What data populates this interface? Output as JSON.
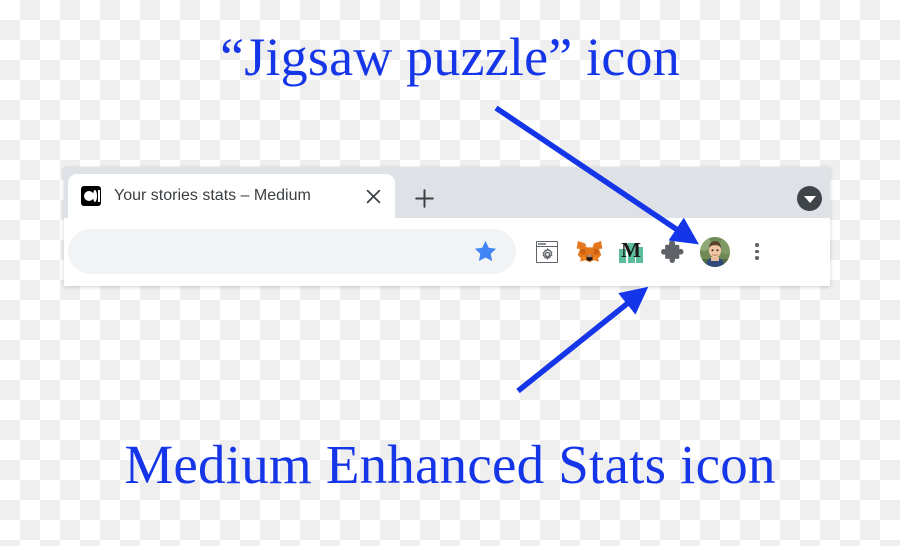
{
  "annotations": {
    "top": "“Jigsaw puzzle” icon",
    "bottom": "Medium Enhanced Stats icon",
    "arrow_color": "#1536e8",
    "text_color": "#1536e8"
  },
  "browser": {
    "tab_strip": {
      "tabs": [
        {
          "title": "Your stories stats – Medium",
          "favicon": "medium-favicon",
          "close_label": "×",
          "active": true
        }
      ],
      "new_tab_label": "+",
      "tab_list_icon": "caret-down-icon"
    },
    "toolbar": {
      "omnibox": {
        "value": "",
        "placeholder": "",
        "bookmark_icon": "star-icon",
        "bookmark_color": "#4285f4"
      },
      "extensions": [
        {
          "name": "window-gear-extension-icon",
          "label": "",
          "color": "#5f6368"
        },
        {
          "name": "metamask-fox-icon",
          "label": "",
          "color": "#e2761b"
        },
        {
          "name": "medium-enhanced-stats-icon",
          "label": "M",
          "color": "#5cbd9d"
        },
        {
          "name": "extensions-puzzle-icon",
          "label": "",
          "color": "#5f6368"
        }
      ],
      "profile": {
        "name": "avatar",
        "label": ""
      },
      "menu": {
        "name": "three-dot-menu-icon",
        "label": ""
      }
    }
  },
  "colors": {
    "tab_strip_bg": "#dee1e6",
    "toolbar_bg": "#ffffff",
    "omnibox_bg": "#f1f3f4",
    "tab_bg": "#ffffff",
    "tab_title_color": "#3c4043",
    "checker_light": "#ffffff",
    "checker_dark": "#efefef"
  }
}
